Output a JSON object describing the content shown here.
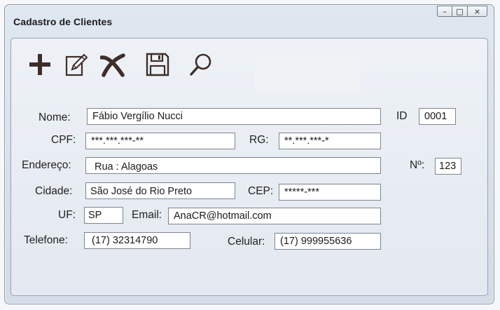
{
  "window": {
    "title": "Cadastro de Clientes",
    "controls": {
      "minimize": "–",
      "maximize": "□",
      "close": "×"
    }
  },
  "toolbar": {
    "items": [
      {
        "name": "add",
        "icon": "plus-icon"
      },
      {
        "name": "edit",
        "icon": "edit-icon"
      },
      {
        "name": "delete",
        "icon": "delete-icon"
      },
      {
        "name": "save",
        "icon": "save-icon"
      },
      {
        "name": "search",
        "icon": "search-icon"
      }
    ]
  },
  "form": {
    "nome": {
      "label": "Nome:",
      "value": "Fábio Vergílio Nucci"
    },
    "id": {
      "label": "ID",
      "value": "0001"
    },
    "cpf": {
      "label": "CPF:",
      "value": "***.***.***-**"
    },
    "rg": {
      "label": "RG:",
      "value": "**.***.***-*"
    },
    "endereco": {
      "label": "Endereço:",
      "value": "Rua : Alagoas"
    },
    "numero": {
      "label": "Nº:",
      "value": "123"
    },
    "cidade": {
      "label": "Cidade:",
      "value": "São José do Rio Preto"
    },
    "cep": {
      "label": "CEP:",
      "value": "*****-***"
    },
    "uf": {
      "label": "UF:",
      "value": "SP"
    },
    "email": {
      "label": "Email:",
      "value": "AnaCR@hotmail.com"
    },
    "telefone": {
      "label": "Telefone:",
      "value": "(17) 32314790"
    },
    "celular": {
      "label": "Celular:",
      "value": "(17) 999955636"
    }
  },
  "colors": {
    "icon": "#3e2d29",
    "field_border": "#7c8591",
    "window_bg": "#dfe7f0"
  }
}
